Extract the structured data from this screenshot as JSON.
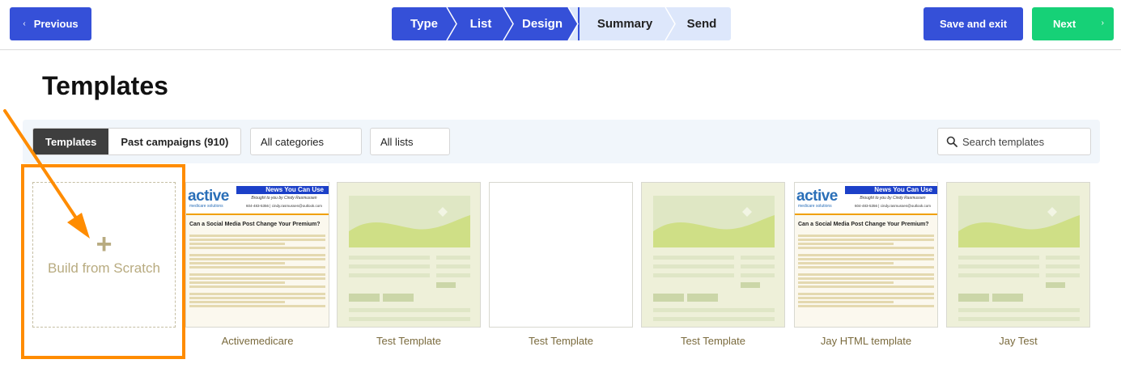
{
  "header": {
    "previous_label": "Previous",
    "steps": [
      {
        "label": "Type",
        "state": "done"
      },
      {
        "label": "List",
        "state": "done"
      },
      {
        "label": "Design",
        "state": "done"
      },
      {
        "label": "Summary",
        "state": "todo"
      },
      {
        "label": "Send",
        "state": "todo"
      }
    ],
    "save_label": "Save and exit",
    "next_label": "Next",
    "colors": {
      "primary": "#3550d8",
      "next": "#16d177",
      "step_pending": "#dde7fb"
    }
  },
  "page_title": "Templates",
  "filters": {
    "tabs": [
      {
        "label": "Templates",
        "active": true
      },
      {
        "label": "Past campaigns (910)",
        "active": false
      }
    ],
    "category_select": "All categories",
    "list_select": "All lists",
    "search_placeholder": "Search templates"
  },
  "scratch": {
    "label": "Build from Scratch",
    "icon": "plus-icon",
    "highlight_color": "#ff8c00"
  },
  "newsletter_preview": {
    "brand": "active",
    "brand_sub": "medicare solutions",
    "banner": "News You Can Use",
    "byline": "Brought to you by Cindy Rasmussen",
    "contact": "604-483-5356 | cindy.rasmussen@outlook.com",
    "headline": "Can a Social Media Post Change Your Premium?"
  },
  "templates": [
    {
      "name": "Activemedicare",
      "thumb": "newsletter"
    },
    {
      "name": "Test Template",
      "thumb": "placeholder"
    },
    {
      "name": "Test Template",
      "thumb": "blank"
    },
    {
      "name": "Test Template",
      "thumb": "placeholder"
    },
    {
      "name": "Jay HTML template",
      "thumb": "newsletter"
    },
    {
      "name": "Jay Test",
      "thumb": "placeholder"
    }
  ]
}
